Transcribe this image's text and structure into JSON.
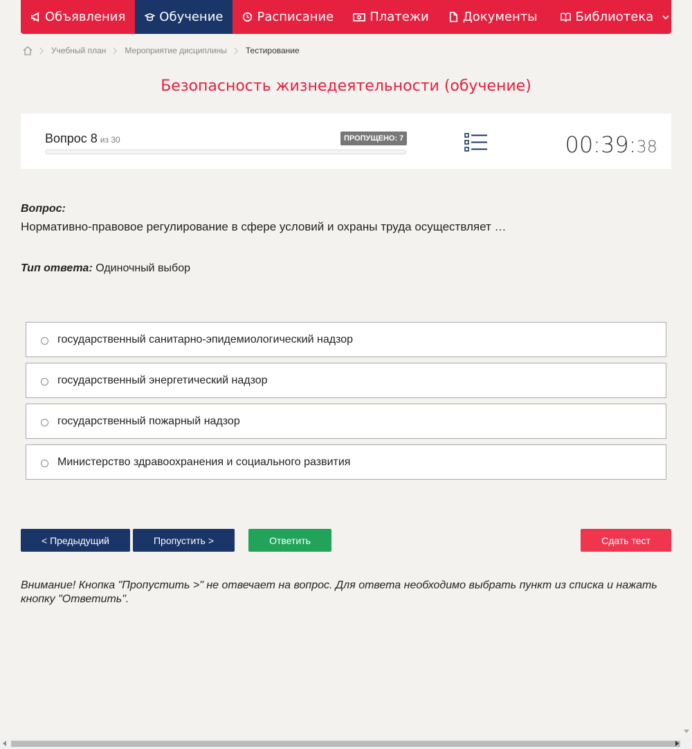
{
  "nav": {
    "items": [
      {
        "label": "Объявления",
        "icon": "megaphone-icon"
      },
      {
        "label": "Обучение",
        "icon": "graduation-cap-icon",
        "active": true
      },
      {
        "label": "Расписание",
        "icon": "clock-icon"
      },
      {
        "label": "Платежи",
        "icon": "money-icon"
      },
      {
        "label": "Документы",
        "icon": "document-icon"
      },
      {
        "label": "Библиотека",
        "icon": "book-icon"
      }
    ]
  },
  "breadcrumb": {
    "items": [
      "Учебный план",
      "Мероприятие дисциплины",
      "Тестирование"
    ]
  },
  "page_title": "Безопасность жизнедеятельности (обучение)",
  "progress": {
    "question_label": "Вопрос 8",
    "of_label": "из 30",
    "skipped_label": "ПРОПУЩЕНО: 7",
    "current": 8,
    "total": 30,
    "fraction": 0
  },
  "timer": {
    "main": "00:39:",
    "seconds": "38"
  },
  "question": {
    "heading": "Вопрос:",
    "text": "Нормативно-правовое регулирование в сфере условий и охраны труда осуществляет …",
    "answer_type_label": "Тип ответа:",
    "answer_type_value": "Одиночный выбор"
  },
  "options": [
    "государственный санитарно-эпидемиологический надзор",
    "государственный энергетический надзор",
    "государственный пожарный надзор",
    "Министерство здравоохранения и социального развития"
  ],
  "buttons": {
    "prev": "< Предыдущий",
    "skip": "Пропустить >",
    "answer": "Ответить",
    "finish": "Сдать тест"
  },
  "notice": "Внимание! Кнопка \"Пропустить >\" не отвечает на вопрос. Для ответа необходимо выбрать пункт из списка и нажать кнопку \"Ответить\".",
  "colors": {
    "brand_red": "#e5213f",
    "nav_active": "#1a3668",
    "answer_green": "#22a35a",
    "finish_red": "#f0364f"
  }
}
